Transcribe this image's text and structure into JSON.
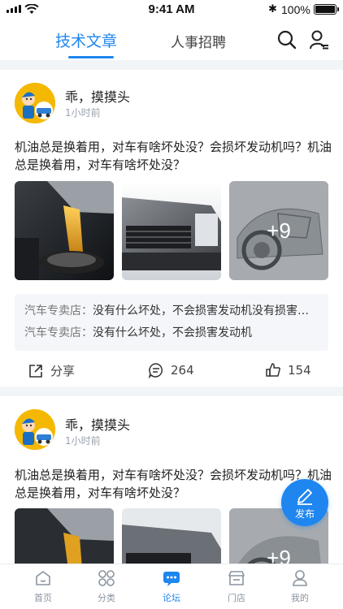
{
  "status_bar": {
    "time": "9:41 AM",
    "battery": "100%"
  },
  "top_tabs": {
    "active": "技术文章",
    "other": "人事招聘"
  },
  "posts": [
    {
      "author": "乖，摸摸头",
      "time": "1小时前",
      "text": "机油总是换着用，对车有啥坏处没？会损坏发动机吗？机油总是换着用，对车有啥坏处没？",
      "more_images": "+9",
      "comments": [
        {
          "who": "汽车专卖店：",
          "text": "没有什么坏处，不会损害发动机没有损害发动机"
        },
        {
          "who": "汽车专卖店：",
          "text": "没有什么坏处，不会损害发动机"
        }
      ],
      "share_label": "分享",
      "comment_count": "264",
      "like_count": "154"
    },
    {
      "author": "乖，摸摸头",
      "time": "1小时前",
      "text": "机油总是换着用，对车有啥坏处没？会损坏发动机吗？机油总是换着用，对车有啥坏处没？",
      "more_images": "+9"
    }
  ],
  "fab": {
    "label": "发布"
  },
  "tab_bar": [
    {
      "label": "首页",
      "icon": "home-icon"
    },
    {
      "label": "分类",
      "icon": "category-icon"
    },
    {
      "label": "论坛",
      "icon": "forum-icon"
    },
    {
      "label": "门店",
      "icon": "store-icon"
    },
    {
      "label": "我的",
      "icon": "profile-icon"
    }
  ],
  "colors": {
    "accent": "#1f86f0",
    "background_band": "#f2f5f8",
    "muted": "#9aa3ae"
  }
}
